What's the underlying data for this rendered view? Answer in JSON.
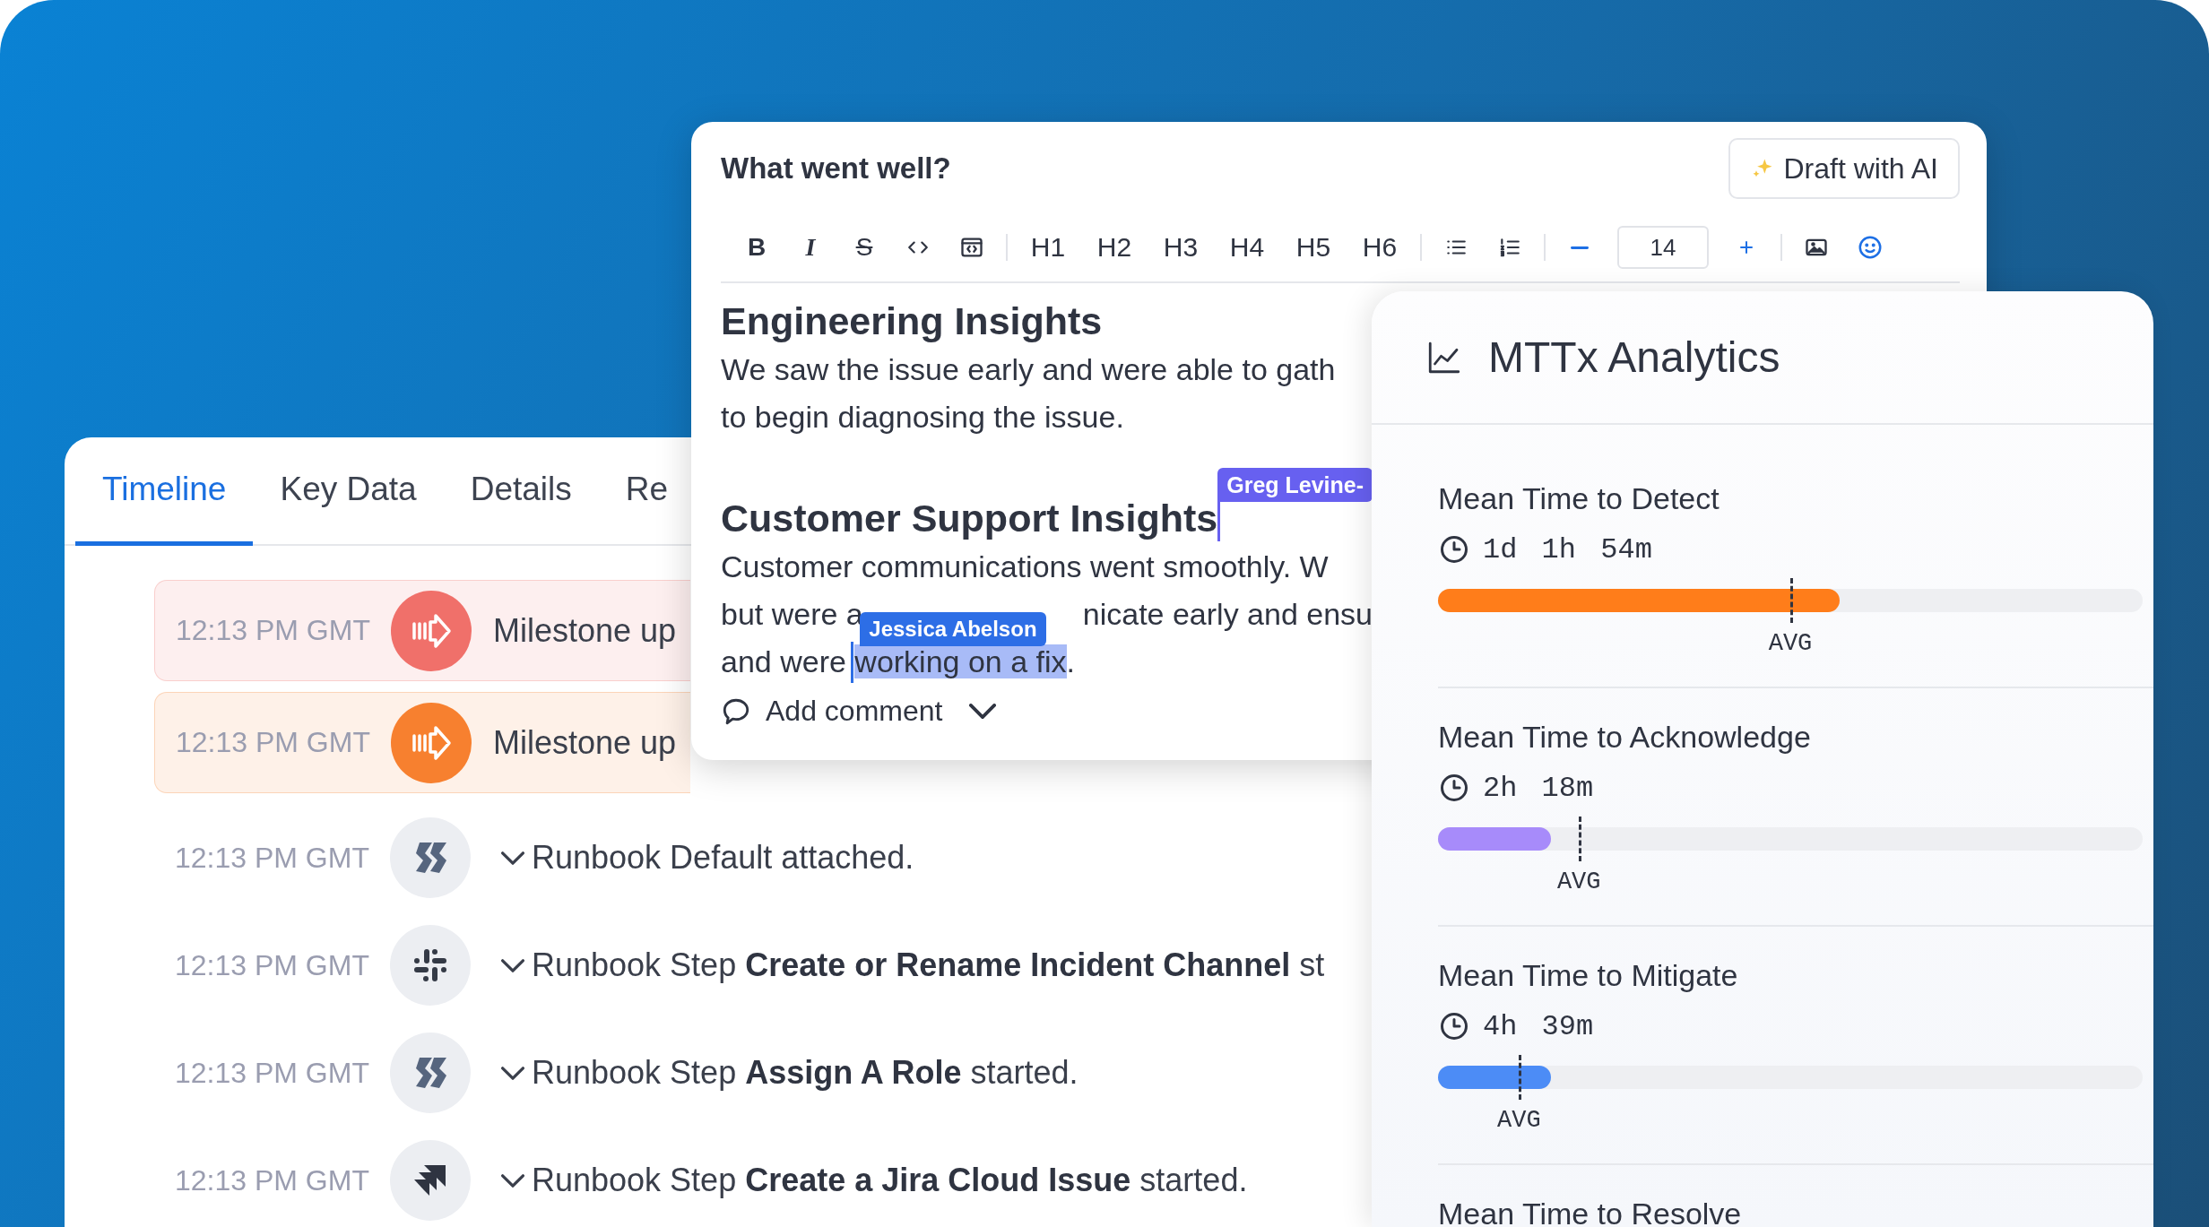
{
  "timeline": {
    "tabs": [
      {
        "label": "Timeline",
        "selected": true
      },
      {
        "label": "Key Data",
        "selected": false
      },
      {
        "label": "Details",
        "selected": false
      },
      {
        "label": "Re",
        "selected": false
      }
    ],
    "events": [
      {
        "kind": "milestone",
        "time": "12:13 PM GMT",
        "text": "Milestone up",
        "color": "#f0706a"
      },
      {
        "kind": "milestone",
        "time": "12:13 PM GMT",
        "text": "Milestone up",
        "color": "#f7802f"
      },
      {
        "kind": "runbook",
        "time": "12:13 PM GMT",
        "text": "Runbook Default attached."
      },
      {
        "kind": "chat",
        "time": "12:13 PM GMT",
        "text": "Runbook Step **Create or Rename Incident Channel** st"
      },
      {
        "kind": "runbook",
        "time": "12:13 PM GMT",
        "text": "Runbook Step **Assign A Role** started."
      },
      {
        "kind": "tracker",
        "time": "12:13 PM GMT",
        "text": "Runbook Step **Create a Jira Cloud Issue** started."
      }
    ]
  },
  "editor": {
    "title": "What went well?",
    "draft_button": "Draft with AI",
    "toolbar": [
      [
        {
          "kind": "bold",
          "label": "B"
        },
        {
          "kind": "italic",
          "label": "I"
        },
        {
          "kind": "strike",
          "label": "S"
        },
        {
          "kind": "code"
        },
        {
          "kind": "codeblock"
        }
      ],
      [
        {
          "kind": "heading",
          "label": "H1"
        },
        {
          "kind": "heading",
          "label": "H2"
        },
        {
          "kind": "heading",
          "label": "H3"
        },
        {
          "kind": "heading",
          "label": "H4"
        },
        {
          "kind": "heading",
          "label": "H5"
        },
        {
          "kind": "heading",
          "label": "H6"
        }
      ],
      [
        {
          "kind": "bullets"
        },
        {
          "kind": "numbers"
        }
      ],
      [
        {
          "kind": "decrease"
        },
        {
          "kind": "size",
          "value": "14"
        },
        {
          "kind": "increase"
        }
      ],
      [
        {
          "kind": "image"
        },
        {
          "kind": "emoji"
        }
      ]
    ],
    "content": [
      {
        "kind": "heading",
        "text": "Engineering Insights"
      },
      {
        "kind": "line",
        "text": "We saw the issue early and were able to gath"
      },
      {
        "kind": "line",
        "text": "to begin diagnosing the issue."
      },
      {
        "kind": "heading",
        "text": "Customer Support Insights",
        "cursor": {
          "name": "Greg Levine-",
          "color": "#6760f0"
        }
      },
      {
        "kind": "line",
        "text": "Customer communications went smoothly. W"
      },
      {
        "kind": "split",
        "parts": [
          "but were a",
          "nicate early and ensu"
        ]
      },
      {
        "kind": "selection",
        "before": "and were ",
        "selected": "working on a fix",
        "after": ".",
        "cursor": {
          "name": "Jessica Abelson",
          "color": "#2d6ee6"
        }
      }
    ],
    "comment": "Add comment"
  },
  "analytics": {
    "title": "MTTx Analytics",
    "metrics": [
      {
        "label": "Mean Time to Detect",
        "value": "1d 1h 54m",
        "color": "#ff7d1a",
        "level": 0.57,
        "avg": {
          "label": "AVG",
          "level": 0.5
        }
      },
      {
        "label": "Mean Time to Acknowledge",
        "value": "2h 18m",
        "color": "#a78bfa",
        "level": 0.16,
        "avg": {
          "label": "AVG",
          "level": 0.2
        }
      },
      {
        "label": "Mean Time to Mitigate",
        "value": "4h 39m",
        "color": "#4c8cf6",
        "level": 0.16,
        "avg": {
          "label": "AVG",
          "level": 0.115
        }
      },
      {
        "label": "Mean Time to Resolve"
      }
    ]
  }
}
